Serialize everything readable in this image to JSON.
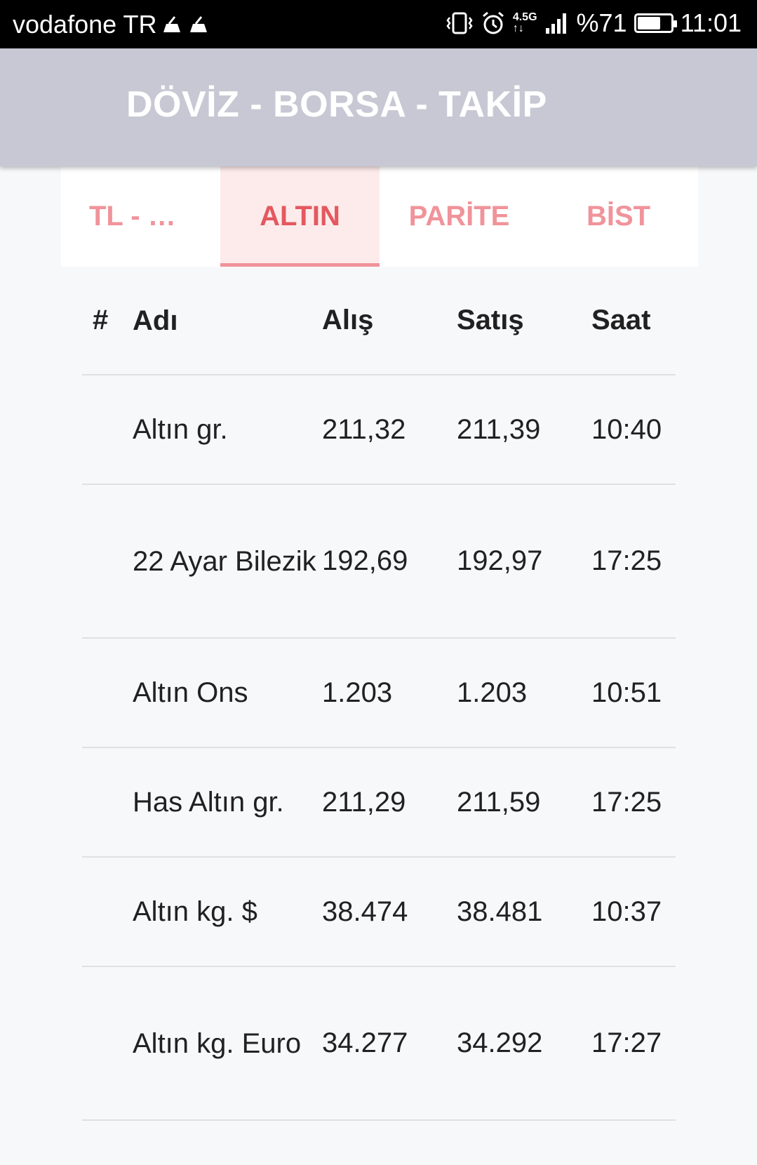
{
  "status_bar": {
    "carrier": "vodafone TR",
    "network": "4.5G",
    "battery_percent": "%71",
    "battery_level": 0.71,
    "time": "11:01",
    "icons": [
      "usb-debug-icon",
      "usb-icon",
      "vibrate-icon",
      "alarm-icon",
      "signal-icon",
      "battery-icon"
    ]
  },
  "app_bar": {
    "title": "DÖVİZ - BORSA - TAKİP"
  },
  "tabs": [
    {
      "label": "TL - DÖVİZ",
      "active": false
    },
    {
      "label": "ALTIN",
      "active": true
    },
    {
      "label": "PARİTE",
      "active": false
    },
    {
      "label": "BİST",
      "active": false
    }
  ],
  "table": {
    "headers": {
      "idx": "#",
      "name": "Adı",
      "buy": "Alış",
      "sell": "Satış",
      "time": "Saat"
    },
    "rows": [
      {
        "name": "Altın gr.",
        "buy": "211,32",
        "sell": "211,39",
        "time": "10:40"
      },
      {
        "name": "22 Ayar Bilezik",
        "buy": "192,69",
        "sell": "192,97",
        "time": "17:25"
      },
      {
        "name": "Altın Ons",
        "buy": "1.203",
        "sell": "1.203",
        "time": "10:51"
      },
      {
        "name": "Has Altın gr.",
        "buy": "211,29",
        "sell": "211,59",
        "time": "17:25"
      },
      {
        "name": "Altın kg. $",
        "buy": "38.474",
        "sell": "38.481",
        "time": "10:37"
      },
      {
        "name": "Altın kg. Euro",
        "buy": "34.277",
        "sell": "34.292",
        "time": "17:27"
      }
    ]
  },
  "colors": {
    "app_bar_bg": "#c8c8d4",
    "tab_text": "#f0939a",
    "tab_active_text": "#e4585f",
    "tab_active_bg": "#fdebeb",
    "page_bg": "#f7f8fa"
  }
}
